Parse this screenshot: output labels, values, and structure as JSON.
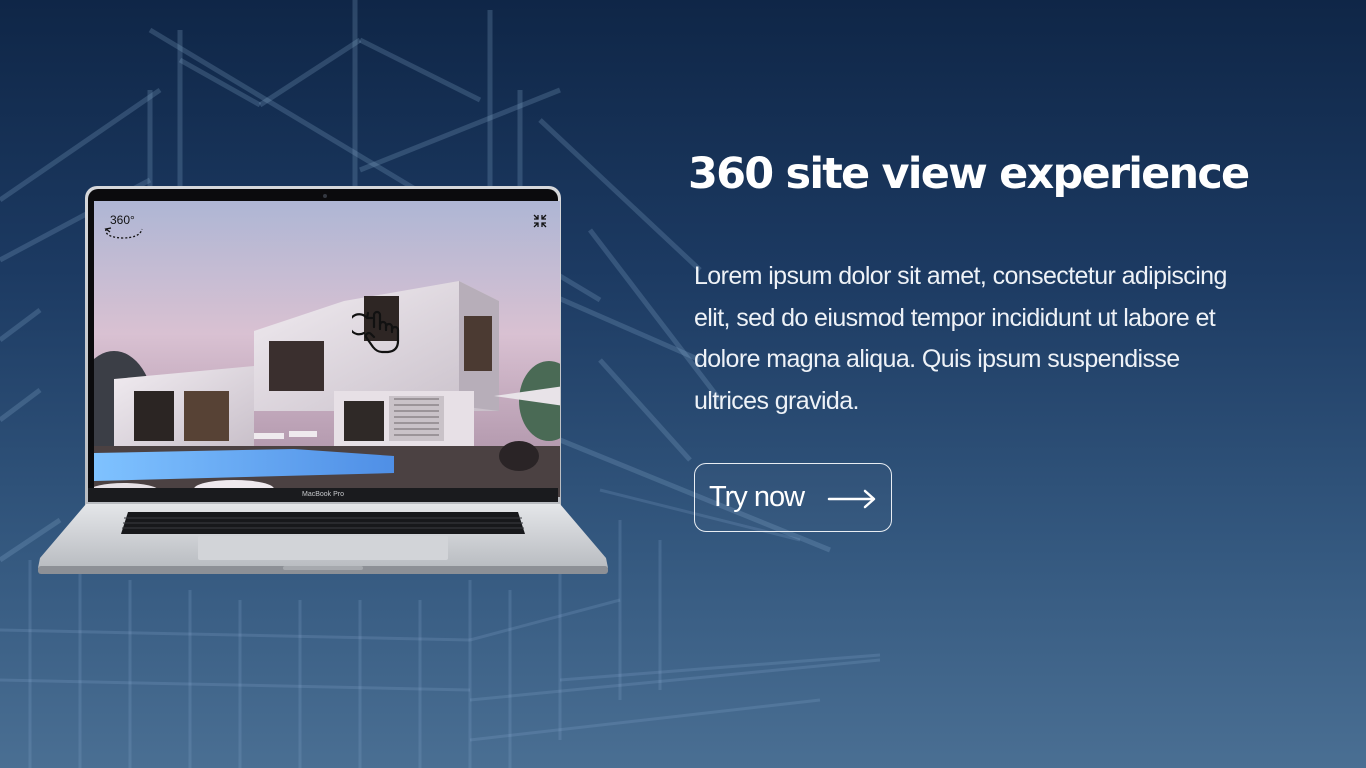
{
  "hero": {
    "title": "360 site view experience",
    "description": "Lorem ipsum dolor sit amet, consectetur adipiscing elit, sed do eiusmod tempor incididunt ut labore et dolore magna aliqua. Quis ipsum suspendisse ultrices gravida.",
    "cta_label": "Try now",
    "cta_icon": "arrow-right-icon"
  },
  "laptop": {
    "brand": "MacBook Pro",
    "screen": {
      "badge_text": "360°",
      "badge_icon": "rotate-360-icon",
      "fullscreen_icon": "collapse-icon",
      "drag_icon": "hand-drag-icon"
    }
  },
  "colors": {
    "background_top": "#0f2647",
    "background_bottom": "#4a6f93",
    "text": "#ffffff",
    "button_border": "#e8edf3"
  }
}
